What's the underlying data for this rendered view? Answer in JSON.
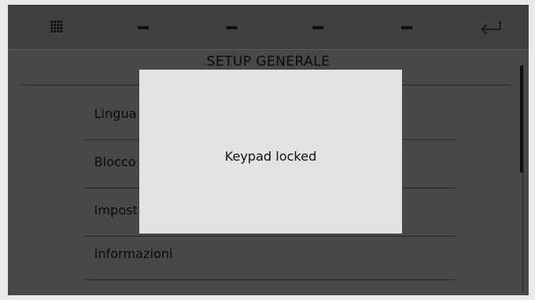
{
  "topbar": {
    "menu_icon": "grid-icon",
    "placeholders": [
      "–",
      "–",
      "–",
      "–"
    ],
    "back_icon": "enter-return-icon"
  },
  "page": {
    "title": "SETUP GENERALE"
  },
  "menu": {
    "items": [
      {
        "label": "Lingua"
      },
      {
        "label": "Blocco"
      },
      {
        "label": "Impost"
      },
      {
        "label": "Informazioni"
      }
    ]
  },
  "modal": {
    "message": "Keypad locked"
  }
}
